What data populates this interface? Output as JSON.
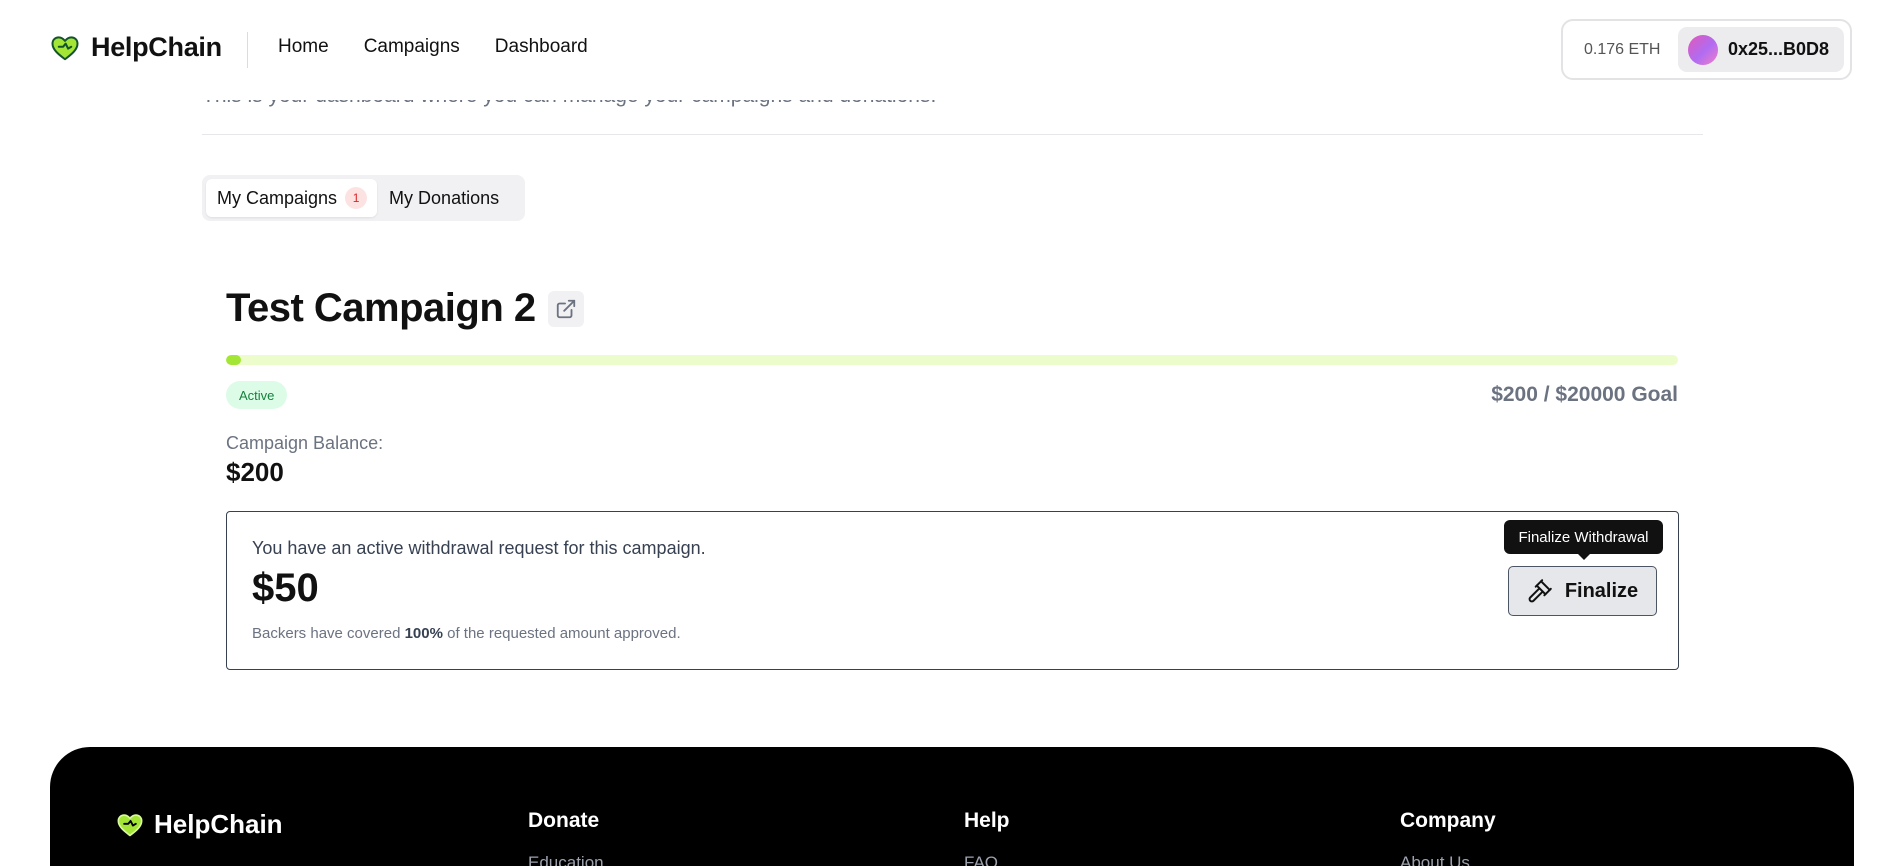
{
  "header": {
    "brand": "HelpChain",
    "nav": [
      "Home",
      "Campaigns",
      "Dashboard"
    ],
    "wallet": {
      "balance": "0.176 ETH",
      "address": "0x25...B0D8"
    }
  },
  "page": {
    "subtitle": "This is your dashboard where you can manage your campaigns and donations.",
    "tabs": {
      "campaigns": "My Campaigns",
      "campaigns_count": "1",
      "donations": "My Donations"
    }
  },
  "campaign": {
    "title": "Test Campaign 2",
    "status": "Active",
    "raised_fraction": 0.01,
    "goal_text": "$200 / $20000 Goal",
    "balance_label": "Campaign Balance:",
    "balance_value": "$200",
    "withdrawal": {
      "message": "You have an active withdrawal request for this campaign.",
      "amount": "$50",
      "note_prefix": "Backers have covered ",
      "note_percent": "100%",
      "note_suffix": " of the requested amount approved.",
      "button_label": "Finalize",
      "tooltip": "Finalize Withdrawal"
    }
  },
  "footer": {
    "brand": "HelpChain",
    "columns": [
      {
        "title": "Donate",
        "link": "Education"
      },
      {
        "title": "Help",
        "link": "FAQ"
      },
      {
        "title": "Company",
        "link": "About Us"
      }
    ]
  },
  "colors": {
    "accent": "#a3e635",
    "accent_track": "#ecfccb",
    "status_bg": "#dcfce7",
    "status_text": "#15803d",
    "badge_bg": "#fde2e2",
    "badge_text": "#dc2626"
  }
}
